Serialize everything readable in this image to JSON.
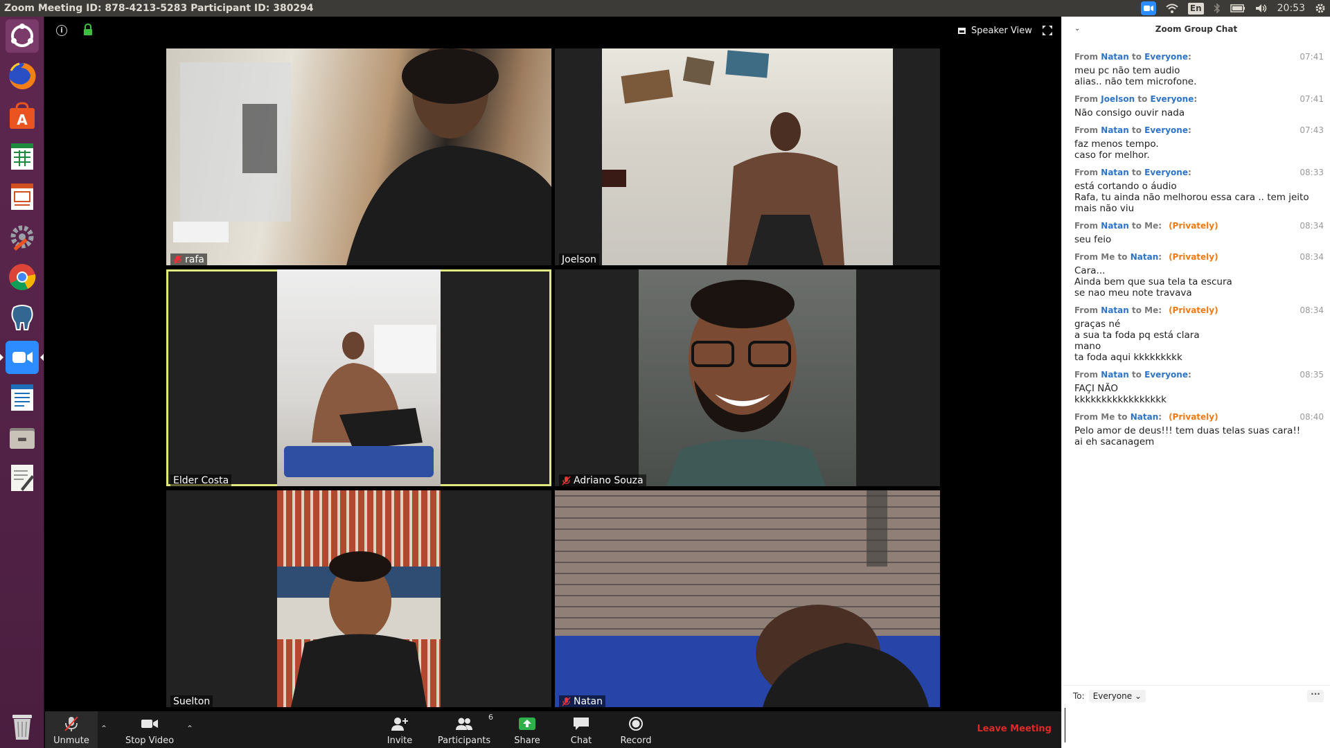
{
  "window": {
    "title": "Zoom Meeting ID: 878-4213-5283 Participant ID: 380294"
  },
  "tray": {
    "language": "En",
    "clock": "20:53",
    "icons": [
      "zoom-icon",
      "wifi-icon",
      "language-icon",
      "bluetooth-icon",
      "battery-icon",
      "volume-icon",
      "clock",
      "settings-gear-icon"
    ]
  },
  "launcher": {
    "apps": [
      "ubuntu-logo-icon",
      "firefox-icon",
      "software-center-icon",
      "spreadsheet-icon",
      "presentation-icon",
      "system-settings-icon",
      "chrome-icon",
      "pgadmin-elephant-icon",
      "zoom-icon",
      "document-writer-icon",
      "file-manager-icon",
      "text-editor-icon",
      "trash-icon"
    ]
  },
  "meeting": {
    "view_label": "Speaker View",
    "participants": [
      {
        "name": "rafa",
        "muted": true,
        "active": false
      },
      {
        "name": "Joelson",
        "muted": false,
        "active": false
      },
      {
        "name": "Elder Costa",
        "muted": false,
        "active": true
      },
      {
        "name": "Adriano Souza",
        "muted": true,
        "active": false
      },
      {
        "name": "Suelton",
        "muted": false,
        "active": false
      },
      {
        "name": "Natan",
        "muted": true,
        "active": false
      }
    ]
  },
  "toolbar": {
    "unmute": "Unmute",
    "stop_video": "Stop Video",
    "invite": "Invite",
    "participants": "Participants",
    "participants_count": "6",
    "share": "Share",
    "chat": "Chat",
    "record": "Record",
    "leave": "Leave Meeting"
  },
  "chat": {
    "title": "Zoom Group Chat",
    "to_label": "To:",
    "to_value": "Everyone",
    "more": "···",
    "messages": [
      {
        "from": "Natan",
        "to": "Everyone",
        "private": "",
        "time": "07:41",
        "text": "meu pc não tem audio\nalias.. não tem microfone."
      },
      {
        "from": "Joelson",
        "to": "Everyone",
        "private": "",
        "time": "07:41",
        "text": "Não consigo ouvir nada"
      },
      {
        "from": "Natan",
        "to": "Everyone",
        "private": "",
        "time": "07:43",
        "text": "faz menos tempo.\ncaso for melhor."
      },
      {
        "from": "Natan",
        "to": "Everyone",
        "private": "",
        "time": "08:33",
        "text": "está cortando o áudio\nRafa, tu ainda não melhorou essa cara .. tem jeito\nmais não viu"
      },
      {
        "from": "Natan",
        "to": "Me",
        "private": "(Privately)",
        "time": "08:34",
        "text": "seu feio"
      },
      {
        "from": "Me",
        "to": "Natan",
        "private": "(Privately)",
        "time": "08:34",
        "text": "Cara...\nAinda bem que sua tela ta escura\nse nao meu note travava"
      },
      {
        "from": "Natan",
        "to": "Me",
        "private": "(Privately)",
        "time": "08:34",
        "text": "graças né\na sua ta foda pq está clara\nmano\nta foda aqui kkkkkkkkk"
      },
      {
        "from": "Natan",
        "to": "Everyone",
        "private": "",
        "time": "08:35",
        "text": "FAÇI NÃO\nkkkkkkkkkkkkkkkkk"
      },
      {
        "from": "Me",
        "to": "Natan",
        "private": "(Privately)",
        "time": "08:40",
        "text": "Pelo amor de deus!!! tem duas telas suas cara!!\nai eh sacanagem"
      }
    ]
  },
  "colors": {
    "zoom_blue": "#2d8cff",
    "chat_name_blue": "#2d74c9",
    "private_orange": "#ef7a12",
    "leave_red": "#e02828",
    "active_speaker_outline": "#e0e880",
    "launcher_purple": "#5e2750"
  }
}
